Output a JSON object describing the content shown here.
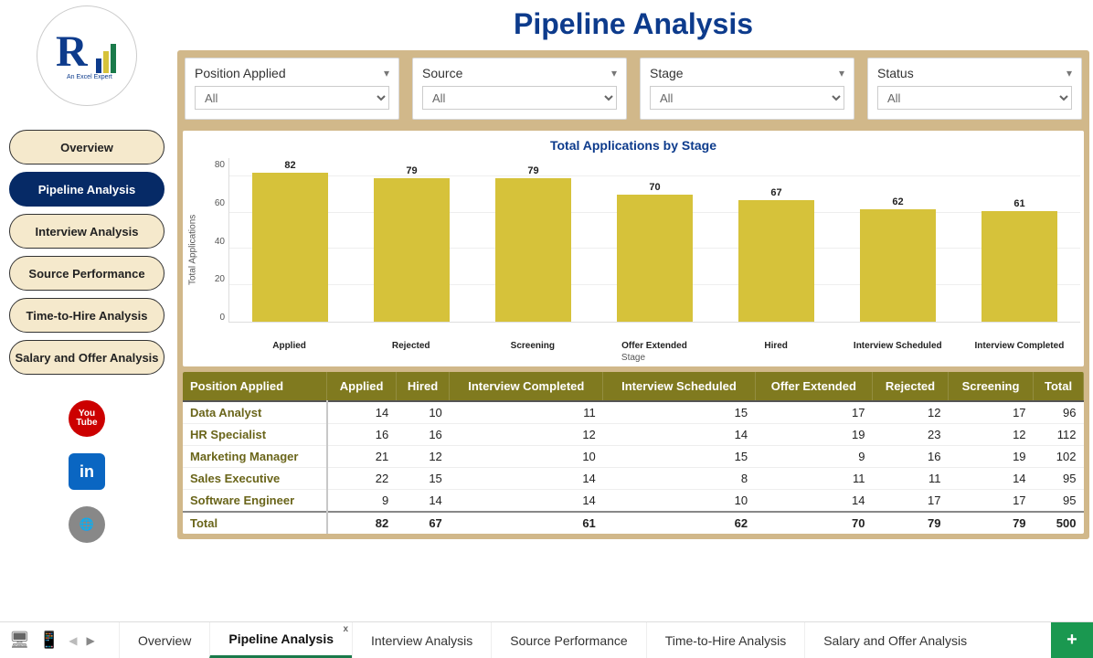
{
  "title": "Pipeline Analysis",
  "nav": [
    {
      "id": "overview",
      "label": "Overview",
      "active": false
    },
    {
      "id": "pipeline",
      "label": "Pipeline Analysis",
      "active": true
    },
    {
      "id": "interview",
      "label": "Interview Analysis",
      "active": false
    },
    {
      "id": "source",
      "label": "Source Performance",
      "active": false
    },
    {
      "id": "timetohire",
      "label": "Time-to-Hire Analysis",
      "active": false
    },
    {
      "id": "salary",
      "label": "Salary and Offer Analysis",
      "active": false
    }
  ],
  "slicers": {
    "position": {
      "label": "Position Applied",
      "value": "All"
    },
    "source": {
      "label": "Source",
      "value": "All"
    },
    "stage": {
      "label": "Stage",
      "value": "All"
    },
    "status": {
      "label": "Status",
      "value": "All"
    }
  },
  "chart_data": {
    "type": "bar",
    "title": "Total Applications by Stage",
    "xlabel": "Stage",
    "ylabel": "Total Applications",
    "ylim": [
      0,
      90
    ],
    "yticks": [
      0,
      20,
      40,
      60,
      80
    ],
    "categories": [
      "Applied",
      "Rejected",
      "Screening",
      "Offer Extended",
      "Hired",
      "Interview Scheduled",
      "Interview Completed"
    ],
    "values": [
      82,
      79,
      79,
      70,
      67,
      62,
      61
    ]
  },
  "pivot": {
    "columns": [
      "Position Applied",
      "Applied",
      "Hired",
      "Interview Completed",
      "Interview Scheduled",
      "Offer Extended",
      "Rejected",
      "Screening",
      "Total"
    ],
    "rows": [
      {
        "label": "Data Analyst",
        "cells": [
          14,
          10,
          11,
          15,
          17,
          12,
          17,
          96
        ]
      },
      {
        "label": "HR Specialist",
        "cells": [
          16,
          16,
          12,
          14,
          19,
          23,
          12,
          112
        ]
      },
      {
        "label": "Marketing Manager",
        "cells": [
          21,
          12,
          10,
          15,
          9,
          16,
          19,
          102
        ]
      },
      {
        "label": "Sales Executive",
        "cells": [
          22,
          15,
          14,
          8,
          11,
          11,
          14,
          95
        ]
      },
      {
        "label": "Software Engineer",
        "cells": [
          9,
          14,
          14,
          10,
          14,
          17,
          17,
          95
        ]
      }
    ],
    "total": {
      "label": "Total",
      "cells": [
        82,
        67,
        61,
        62,
        70,
        79,
        79,
        500
      ]
    }
  },
  "tabs": [
    {
      "label": "Overview",
      "active": false
    },
    {
      "label": "Pipeline Analysis",
      "active": true,
      "closable": true
    },
    {
      "label": "Interview Analysis",
      "active": false
    },
    {
      "label": "Source Performance",
      "active": false
    },
    {
      "label": "Time-to-Hire Analysis",
      "active": false
    },
    {
      "label": "Salary and Offer Analysis",
      "active": false
    }
  ],
  "icons": {
    "youtube": "You\nTube",
    "linkedin": "in",
    "web": "🌐"
  }
}
